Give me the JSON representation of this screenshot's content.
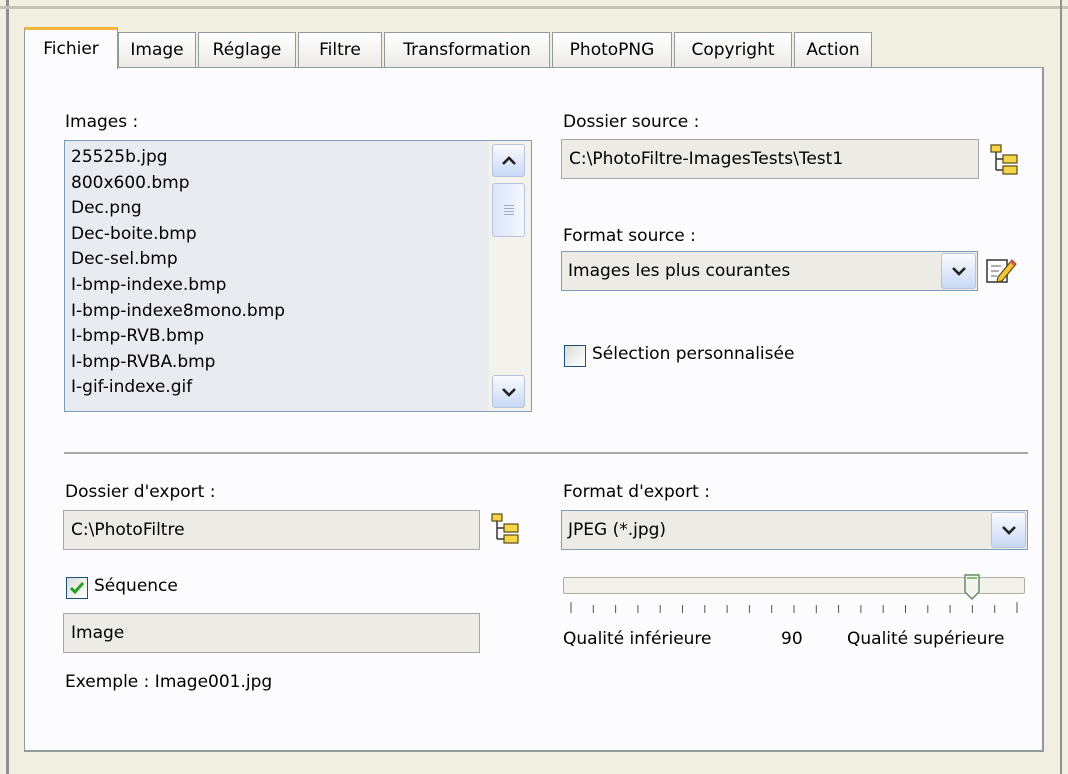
{
  "tabs": [
    "Fichier",
    "Image",
    "Réglage",
    "Filtre",
    "Transformation",
    "PhotoPNG",
    "Copyright",
    "Action"
  ],
  "images": {
    "label": "Images :",
    "items": [
      "25525b.jpg",
      "800x600.bmp",
      "Dec.png",
      "Dec-boite.bmp",
      "Dec-sel.bmp",
      "I-bmp-indexe.bmp",
      "I-bmp-indexe8mono.bmp",
      "I-bmp-RVB.bmp",
      "I-bmp-RVBA.bmp",
      "I-gif-indexe.gif"
    ]
  },
  "source": {
    "folder_label": "Dossier source :",
    "folder_value": "C:\\PhotoFiltre-ImagesTests\\Test1",
    "format_label": "Format source :",
    "format_value": "Images les plus courantes",
    "custom_selection_label": "Sélection personnalisée",
    "custom_selection_checked": false
  },
  "export": {
    "folder_label": "Dossier d'export :",
    "folder_value": "C:\\PhotoFiltre",
    "format_label": "Format d'export :",
    "format_value": "JPEG (*.jpg)",
    "sequence_label": "Séquence",
    "sequence_checked": true,
    "sequence_value": "Image",
    "example_text": "Exemple : Image001.jpg"
  },
  "quality": {
    "low_label": "Qualité inférieure",
    "value": "90",
    "high_label": "Qualité supérieure",
    "min": 0,
    "max": 100,
    "ticks": 21
  },
  "colors": {
    "panel_bg": "#fcfcfe",
    "window_bg": "#f1efe2",
    "active_tab_accent": "#f4b33a",
    "field_bg": "#ecebe6",
    "list_bg": "#e8ebf0"
  }
}
